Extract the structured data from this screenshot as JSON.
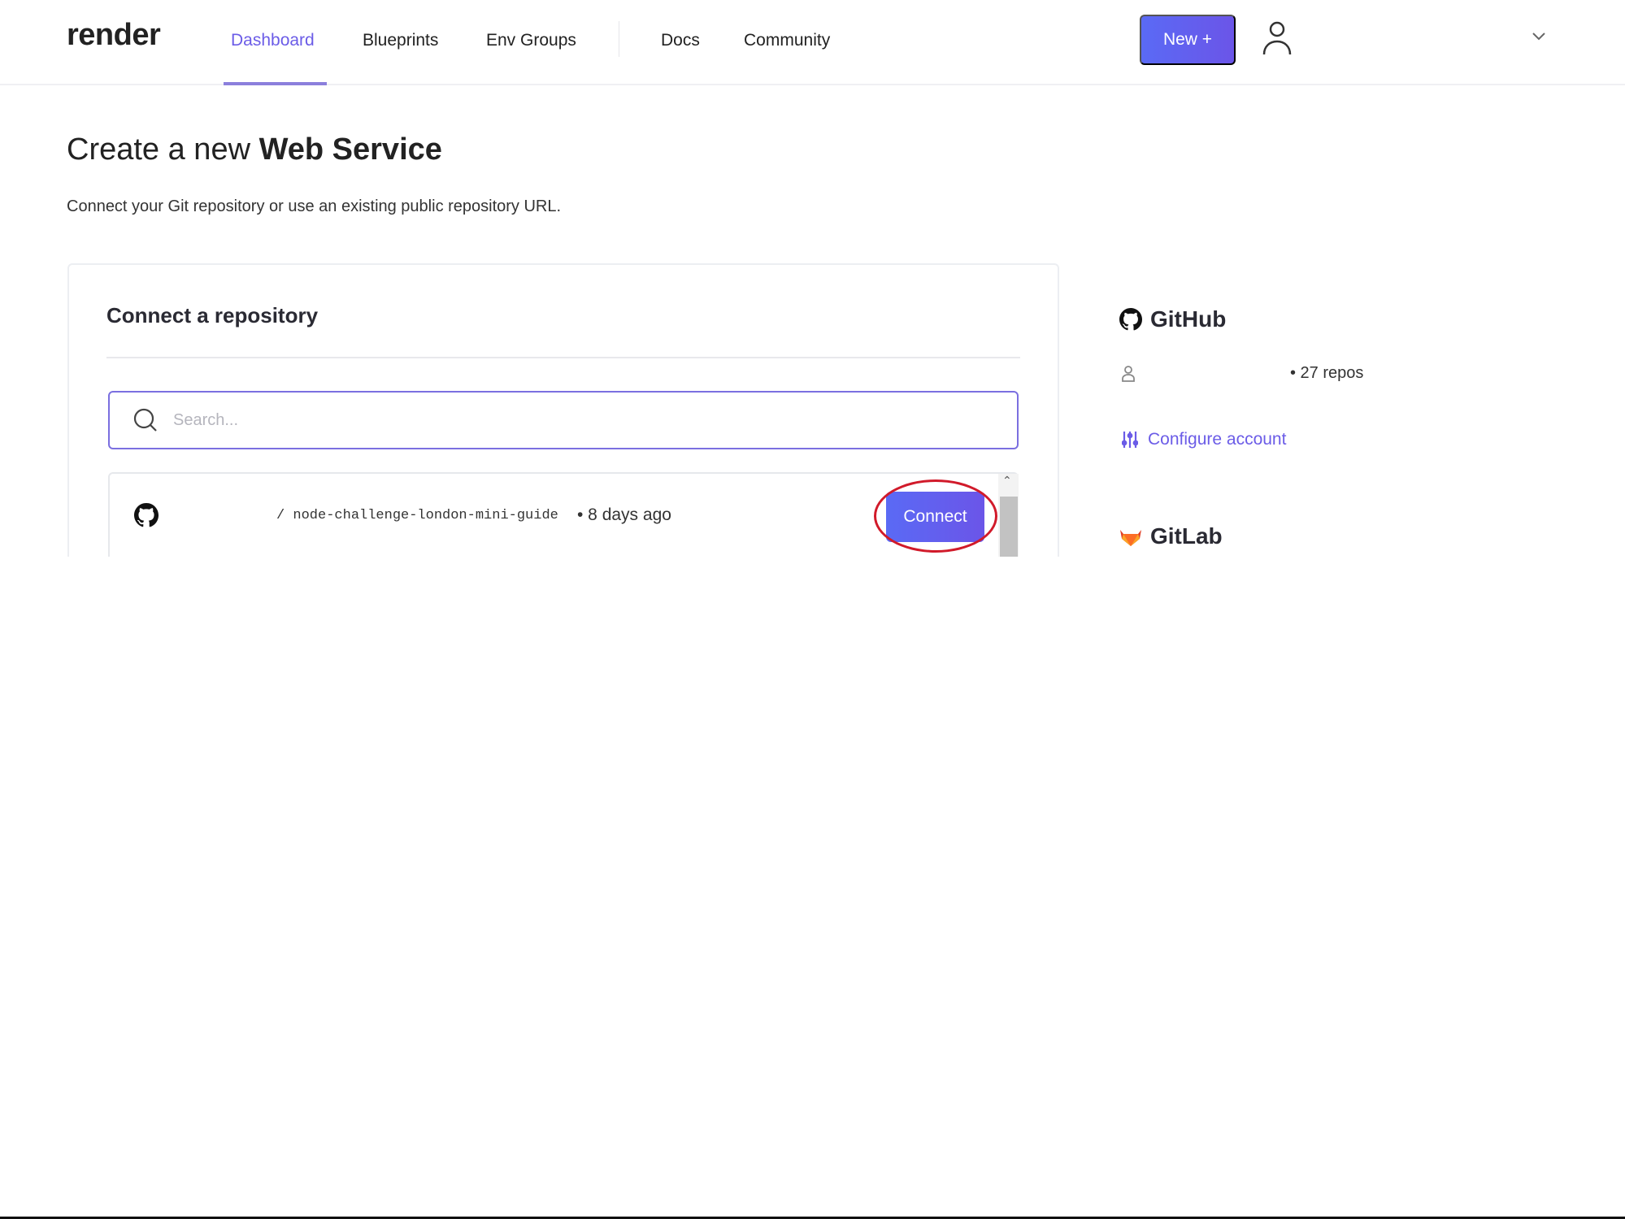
{
  "header": {
    "logo": "render",
    "nav": [
      {
        "label": "Dashboard",
        "active": true
      },
      {
        "label": "Blueprints"
      },
      {
        "label": "Env Groups"
      },
      {
        "label": "Docs"
      },
      {
        "label": "Community"
      }
    ],
    "new_button": "New +",
    "accent_color": "#6b5ce7"
  },
  "page": {
    "title_prefix": "Create a new",
    "title_bold": "Web Service",
    "subtitle": "Connect your Git repository or use an existing public repository URL."
  },
  "card": {
    "title": "Connect a repository",
    "search_placeholder": "Search...",
    "repos": [
      {
        "name": "/ node-challenge-london-mini-guide",
        "updated": "• 8 days ago",
        "action": "Connect"
      }
    ]
  },
  "providers": {
    "github": {
      "label": "GitHub",
      "repo_count": "• 27 repos",
      "configure": "Configure account"
    },
    "gitlab": {
      "label": "GitLab"
    }
  }
}
